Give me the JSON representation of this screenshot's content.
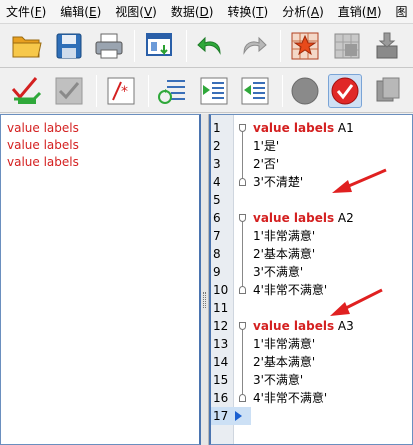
{
  "menus": [
    {
      "text": "文件(",
      "key": "F",
      "end": ")"
    },
    {
      "text": "编辑(",
      "key": "E",
      "end": ")"
    },
    {
      "text": "视图(",
      "key": "V",
      "end": ")"
    },
    {
      "text": "数据(",
      "key": "D",
      "end": ")"
    },
    {
      "text": "转换(",
      "key": "T",
      "end": ")"
    },
    {
      "text": "分析(",
      "key": "A",
      "end": ")"
    },
    {
      "text": "直销(",
      "key": "M",
      "end": ")"
    },
    {
      "text": "图",
      "key": "",
      "end": ""
    }
  ],
  "left_pane": {
    "items": [
      "value labels",
      "value labels",
      "value labels"
    ]
  },
  "syntax": {
    "lines": [
      {
        "num": "1",
        "kw": "value labels",
        "rest": " A1"
      },
      {
        "num": "2",
        "kw": "",
        "rest": "1'是'"
      },
      {
        "num": "3",
        "kw": "",
        "rest": "2'否'"
      },
      {
        "num": "4",
        "kw": "",
        "rest": "3'不清楚'"
      },
      {
        "num": "5",
        "kw": "",
        "rest": ""
      },
      {
        "num": "6",
        "kw": "value labels",
        "rest": " A2"
      },
      {
        "num": "7",
        "kw": "",
        "rest": "1'非常满意'"
      },
      {
        "num": "8",
        "kw": "",
        "rest": "2'基本满意'"
      },
      {
        "num": "9",
        "kw": "",
        "rest": "3'不满意'"
      },
      {
        "num": "10",
        "kw": "",
        "rest": "4'非常不满意'"
      },
      {
        "num": "11",
        "kw": "",
        "rest": ""
      },
      {
        "num": "12",
        "kw": "value labels",
        "rest": " A3"
      },
      {
        "num": "13",
        "kw": "",
        "rest": "1'非常满意'"
      },
      {
        "num": "14",
        "kw": "",
        "rest": "2'基本满意'"
      },
      {
        "num": "15",
        "kw": "",
        "rest": "3'不满意'"
      },
      {
        "num": "16",
        "kw": "",
        "rest": "4'非常不满意'"
      },
      {
        "num": "17",
        "kw": "",
        "rest": ""
      }
    ],
    "current_line": "17"
  },
  "colors": {
    "keyword": "#d42020",
    "annotation_arrow": "#e02020",
    "pane_border": "#4a74b0"
  }
}
